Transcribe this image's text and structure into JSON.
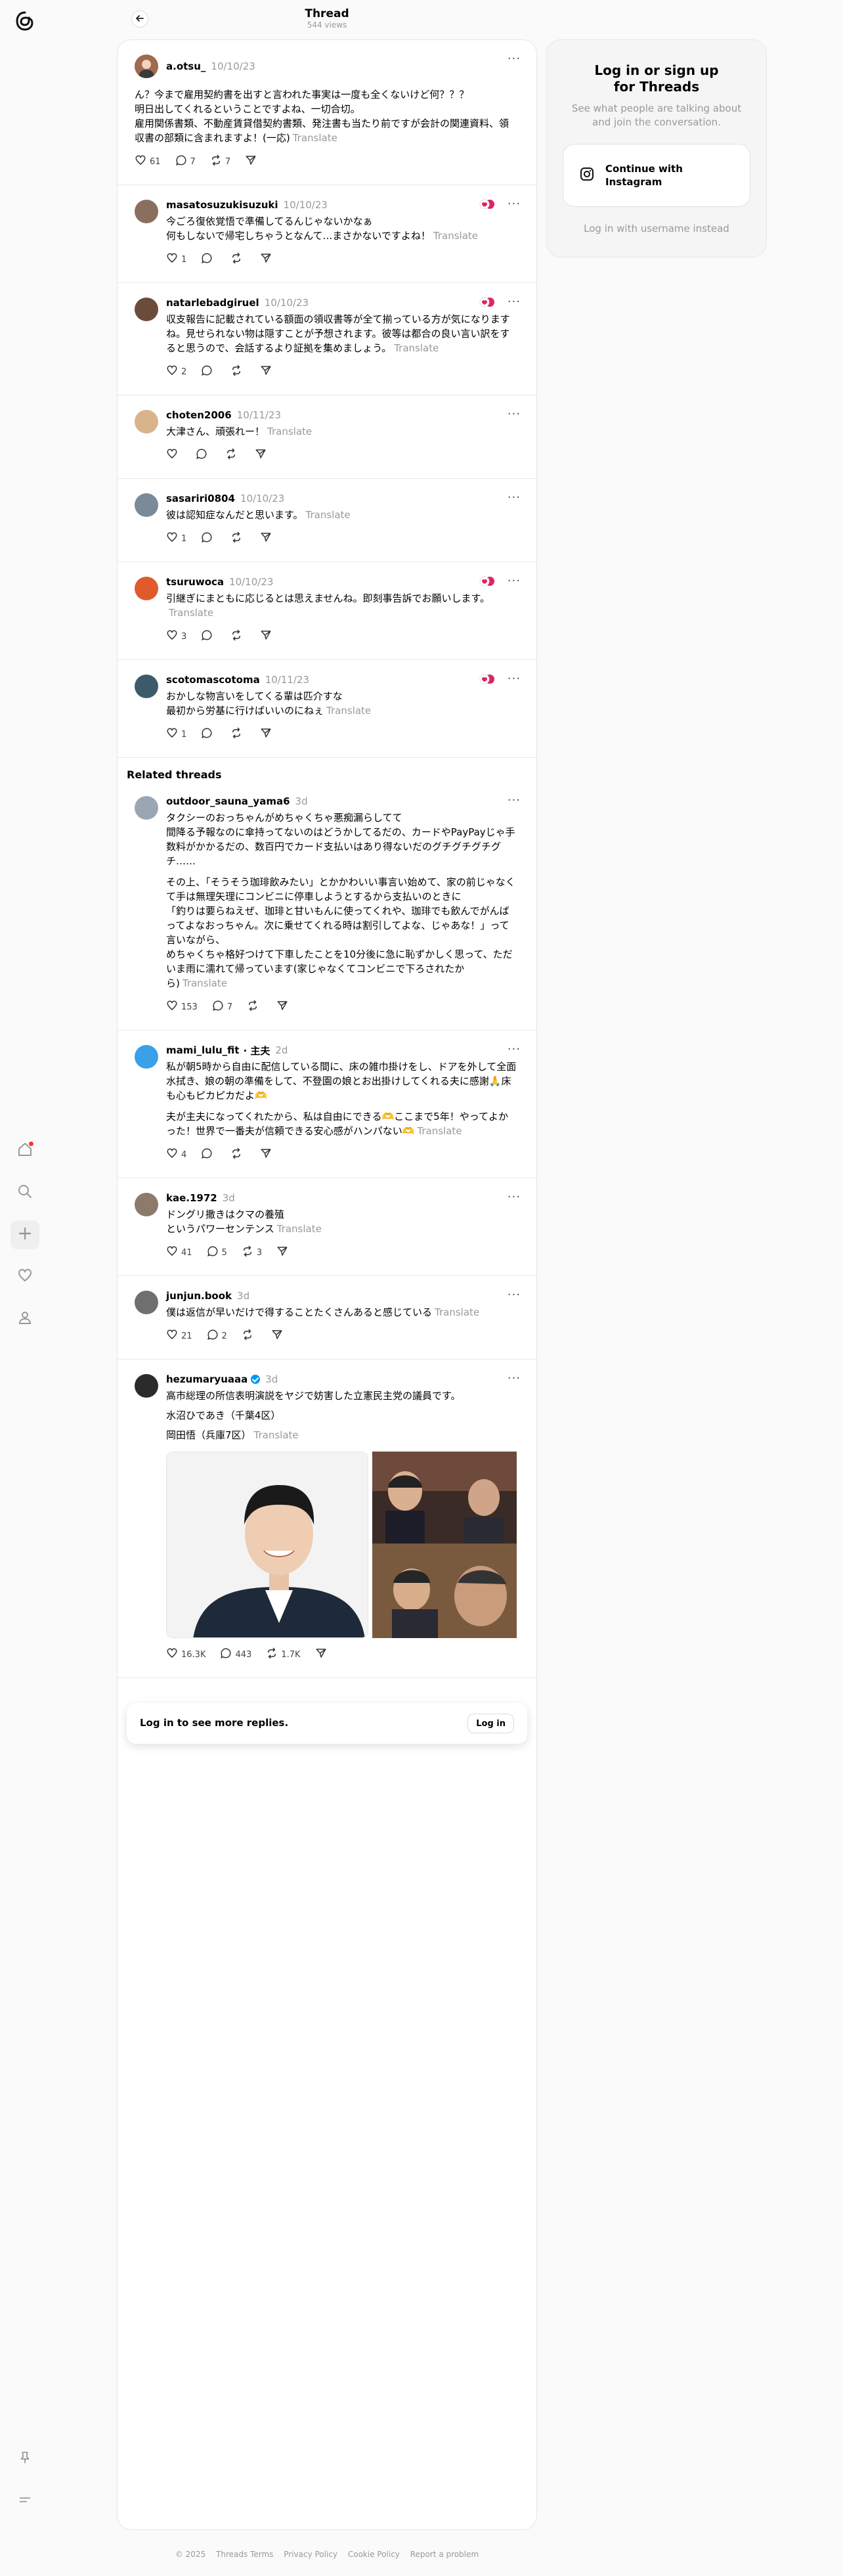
{
  "header": {
    "title": "Thread",
    "views": "544 views"
  },
  "first_post": {
    "username": "a.otsu_",
    "time": "10/10/23",
    "text": "ん？今まで雇用契約書を出すと言われた事実は一度も全くないけど何？？？\n明日出してくれるということですよね、一切合切。\n雇用関係書類、不動産賃貸借契約書類、発注書も当たり前ですが会計の関連資料、領収書の部類に含まれますよ！(一応)",
    "translate": "Translate",
    "likes": "61",
    "replies": "7",
    "reposts": "7"
  },
  "replies": [
    {
      "username": "masatosuzukisuzuki",
      "time": "10/10/23",
      "text": "今ごろ復依覚悟で準備してるんじゃないかなぁ\n何もしないで帰宅しちゃうとなんて…まさかないですよね！",
      "translate": "Translate",
      "likes": "1",
      "replies": "",
      "reposts": ""
    },
    {
      "username": "natarlebadgiruel",
      "time": "10/10/23",
      "text": "収支報告に記載されている額面の領収書等が全て揃っている方が気になりますね。見せられない物は隠すことが予想されます。彼等は都合の良い言い訳をすると思うので、会話するより証拠を集めましょう。",
      "translate": "Translate",
      "likes": "2",
      "replies": "",
      "reposts": ""
    },
    {
      "username": "choten2006",
      "time": "10/11/23",
      "text": "大津さん、頑張れー！",
      "translate": "Translate",
      "likes": "",
      "replies": "",
      "reposts": ""
    },
    {
      "username": "sasariri0804",
      "time": "10/10/23",
      "text": "彼は認知症なんだと思います。",
      "translate": "Translate",
      "likes": "1",
      "replies": "",
      "reposts": ""
    },
    {
      "username": "tsuruwoca",
      "time": "10/10/23",
      "text": "引継ぎにまともに応じるとは思えませんね。即刻事告訴でお願いします。",
      "translate": "Translate",
      "likes": "3",
      "replies": "",
      "reposts": ""
    },
    {
      "username": "scotomascotoma",
      "time": "10/11/23",
      "text": "おかしな物言いをしてくる輩は匹介すな\n最初から労基に行けばいいのにねぇ",
      "translate": "Translate",
      "likes": "1",
      "replies": "",
      "reposts": ""
    }
  ],
  "related_title": "Related threads",
  "related": [
    {
      "username": "outdoor_sauna_yama6",
      "time": "3d",
      "verified": false,
      "text": "タクシーのおっちゃんがめちゃくちゃ悪痴漏らしてて\n間降る予報なのに傘持ってないのはどうかしてるだの、カードやPayPayじゃ手数料がかかるだの、数百円でカード支払いはあり得ないだのグチグチグチグチ……",
      "text2": "その上、「そうそう珈琲飲みたい」とかかわいい事言い始めて、家の前じゃなくて手は無理矢理にコンビニに停車しようとするから支払いのときに\n「釣りは要らねえぜ、珈琲と甘いもんに使ってくれや、珈琲でも飲んでがんばってよなおっちゃん。次に乗せてくれる時は割引してよな、じゃあな！」って言いながら、\nめちゃくちゃ格好つけて下車したことを10分後に急に恥ずかしく思って、ただいま雨に濡れて帰っています(家じゃなくてコンビニで下ろされたから)",
      "translate": "Translate",
      "likes": "153",
      "replies": "7",
      "reposts": ""
    },
    {
      "username": "mami_lulu_fit",
      "time": "2d",
      "verified": false,
      "tag": "· 主夫",
      "text": "私が朝5時から自由に配信している間に、床の雑巾掛けをし、ドアを外して全面水拭き、娘の朝の準備をして、不登園の娘とお出掛けしてくれる夫に感謝🙏床も心もピカピカだよ🫶",
      "text2": "夫が主夫になってくれたから、私は自由にできる🫶ここまで5年！やってよかった！世界で一番夫が信頼できる安心感がハンパない🫶",
      "translate": "Translate",
      "likes": "4",
      "replies": "",
      "reposts": ""
    },
    {
      "username": "kae.1972",
      "time": "3d",
      "verified": false,
      "text": "ドングリ撒きはクマの養殖\nというパワーセンテンス",
      "translate": "Translate",
      "likes": "41",
      "replies": "5",
      "reposts": "3"
    },
    {
      "username": "junjun.book",
      "time": "3d",
      "verified": false,
      "text": "僕は返信が早いだけで得することたくさんあると感じている",
      "translate": "Translate",
      "likes": "21",
      "replies": "2",
      "reposts": ""
    },
    {
      "username": "hezumaryuaaa",
      "time": "3d",
      "verified": true,
      "text": "高市総理の所信表明演説をヤジで妨害した立憲民主党の議員です。",
      "line2": "水沼ひであき（千葉4区）",
      "line3": "岡田悟（兵庫7区）",
      "translate": "Translate",
      "likes": "16.3K",
      "replies": "443",
      "reposts": "1.7K"
    }
  ],
  "login_banner": {
    "text": "Log in to see more replies.",
    "button": "Log in"
  },
  "sidebar": {
    "title": "Log in or sign up\nfor Threads",
    "subtitle": "See what people are talking about and join the conversation.",
    "instagram_button": "Continue with\nInstagram",
    "alt_login": "Log in with username instead"
  },
  "footer": [
    "© 2025",
    "Threads Terms",
    "Privacy Policy",
    "Cookie Policy",
    "Report a problem"
  ],
  "colors": {
    "accent": "#0095f6",
    "muted": "#999999",
    "notification": "#ff3040"
  }
}
